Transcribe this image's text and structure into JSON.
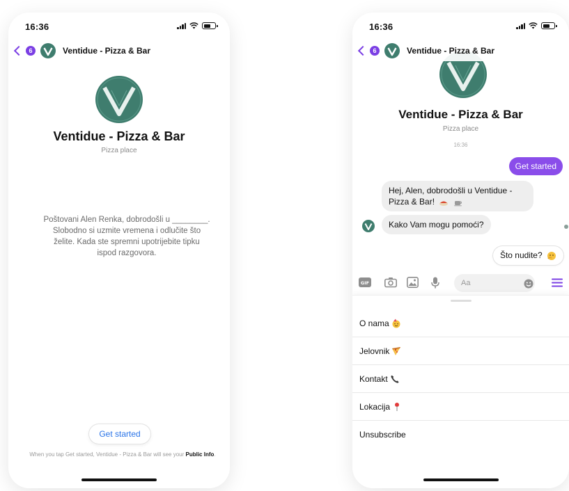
{
  "status": {
    "time": "16:36"
  },
  "nav": {
    "badge_count": "6",
    "title": "Ventidue - Pizza & Bar"
  },
  "page": {
    "name": "Ventidue - Pizza & Bar",
    "type": "Pizza place"
  },
  "welcome": {
    "text": "Poštovani Alen Renka, dobrodošli u ________. Slobodno si uzmite vremena i odlučite što želite. Kada ste spremni upotrijebite tipku ispod razgovora."
  },
  "get_started": {
    "label": "Get started",
    "disclaimer_prefix": "When you tap Get started, Ventidue - Pizza & Bar will see your",
    "disclaimer_link": "Public Info",
    "disclaimer_suffix": "."
  },
  "chat": {
    "timestamp": "16:36",
    "outgoing_1": "Get started",
    "incoming_1": "Hej, Alen, dobrodošli u Ventidue - Pizza & Bar!",
    "incoming_2": "Kako Vam mogu pomoći?",
    "outgoing_2": "Što nudite?"
  },
  "composer": {
    "placeholder": "Aa",
    "icons": [
      "gif-icon",
      "camera-icon",
      "image-icon",
      "microphone-icon",
      "emoji-icon",
      "menu-icon"
    ]
  },
  "menu": {
    "items": [
      {
        "label": "O nama",
        "icon": "party-face-emoji"
      },
      {
        "label": "Jelovnik",
        "icon": "pizza-emoji"
      },
      {
        "label": "Kontakt",
        "icon": "telephone-emoji"
      },
      {
        "label": "Lokacija",
        "icon": "pin-emoji"
      },
      {
        "label": "Unsubscribe",
        "icon": ""
      }
    ]
  },
  "colors": {
    "accent": "#7b3fe4",
    "bubble_out": "#8a4dea",
    "link_blue": "#2a74e8",
    "logo_green": "#3f7d6e",
    "bubble_in": "#eeeeee"
  }
}
